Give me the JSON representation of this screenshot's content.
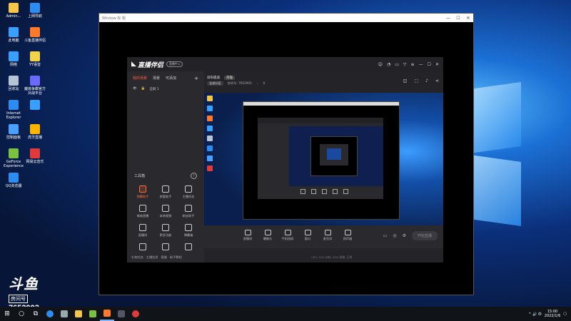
{
  "desktop": {
    "icons": [
      {
        "label": "Admin...",
        "color": "#f3c54a"
      },
      {
        "label": "上网导航",
        "color": "#2d8cf0"
      },
      {
        "label": "此电脑",
        "color": "#3aa0ff"
      },
      {
        "label": "斗鱼直播伴侣",
        "color": "#ff7a2a"
      },
      {
        "label": "网络",
        "color": "#3aa0ff"
      },
      {
        "label": "YY语音",
        "color": "#f3d34a"
      },
      {
        "label": "回收站",
        "color": "#b7c4d6"
      },
      {
        "label": "魔兽争霸官方对战平台",
        "color": "#6a6aff"
      },
      {
        "label": "Internet Explorer",
        "color": "#2d8cf0"
      },
      {
        "label": "",
        "color": "#3aa0ff"
      },
      {
        "label": "控制面板",
        "color": "#4aa0ff"
      },
      {
        "label": "虎牙直播",
        "color": "#ffb400"
      },
      {
        "label": "GeForce Experience",
        "color": "#7ac142"
      },
      {
        "label": "网易云音乐",
        "color": "#e03a3a"
      },
      {
        "label": "QQ浏览器",
        "color": "#2d8cf0"
      }
    ],
    "watermark": {
      "brand": "斗鱼",
      "sub": "房间号",
      "room": "7652903"
    }
  },
  "taskbar": {
    "clock_time": "15:00",
    "clock_date": "2022/1/6",
    "tray_text": "^ 🔊 中"
  },
  "outer_window": {
    "title": "Window 标 题"
  },
  "app": {
    "logo": "直播伴侣",
    "pill": "直播中 ▸",
    "left_tabs": [
      "我的场景",
      "场景",
      "可添加"
    ],
    "scene_item": "全屏 1",
    "tools_label": "工具箱",
    "tools": [
      {
        "label": "弹幕助手",
        "red": true
      },
      {
        "label": "房管助手",
        "red": false
      },
      {
        "label": "主播任务",
        "red": false
      },
      {
        "label": "电商直播",
        "red": false
      },
      {
        "label": "本地视频",
        "red": false
      },
      {
        "label": "粉丝助手",
        "red": false
      },
      {
        "label": "直播间",
        "red": false
      },
      {
        "label": "更多功能",
        "red": false
      },
      {
        "label": "弹幕箱",
        "red": false
      },
      {
        "label": "",
        "red": false
      },
      {
        "label": "",
        "red": false
      },
      {
        "label": "",
        "red": false
      }
    ],
    "left_footer": [
      "礼物任务",
      "主播信息",
      "客服",
      "新手教程"
    ],
    "room_title": "斜阳孤城",
    "room_tag": "英雄",
    "room_category": "全部分区",
    "room_id": "房间号: 7652903",
    "room_likes": "0",
    "bottom_tools": [
      "直播间",
      "摄像头",
      "手机投屏",
      "窗口",
      "麦克风",
      "扬声器"
    ],
    "start_button": "开始直播",
    "status_text": "CPU: 12%  内存: 45%  网络: 正常"
  }
}
